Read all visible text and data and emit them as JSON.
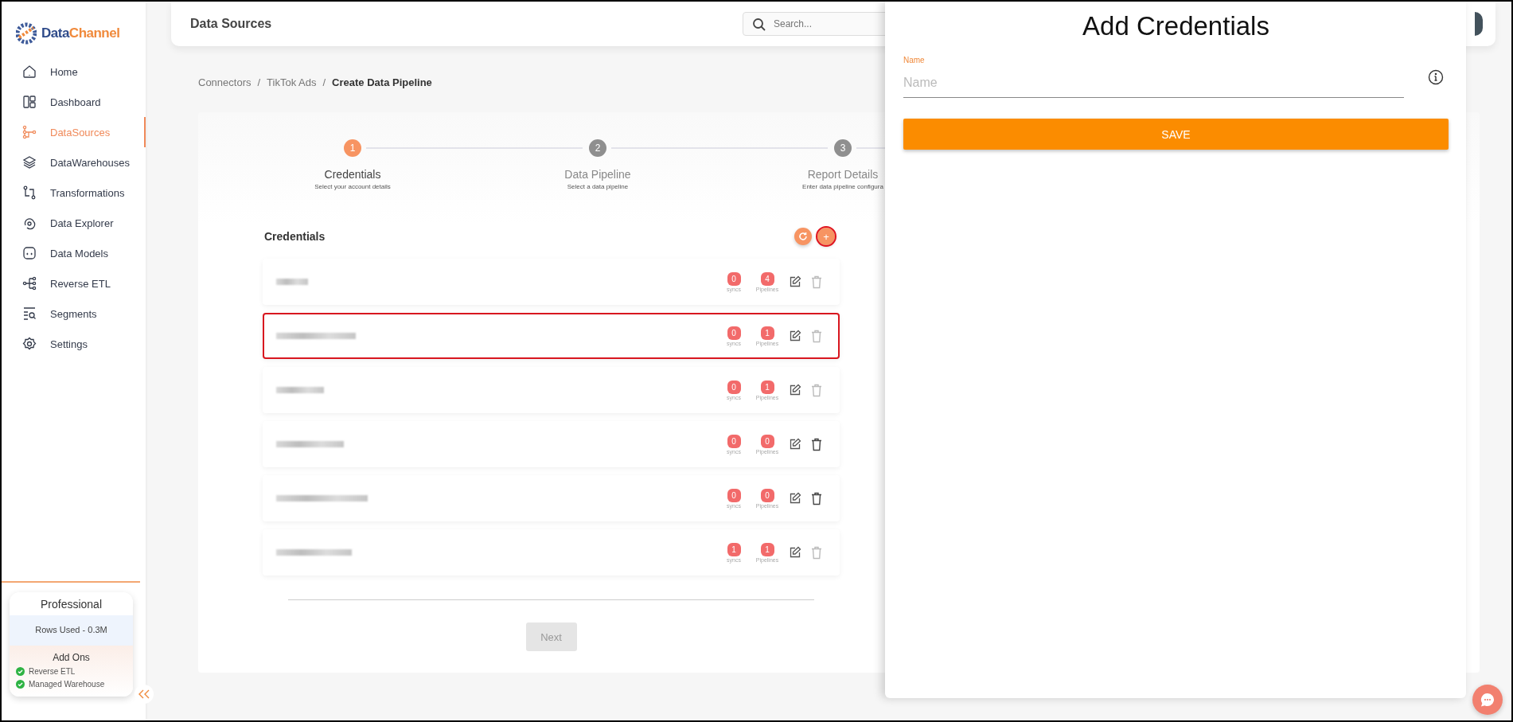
{
  "sidebar": {
    "logo": {
      "first": "Data",
      "second": "Channel"
    },
    "items": [
      {
        "label": "Home",
        "selected": false
      },
      {
        "label": "Dashboard",
        "selected": false
      },
      {
        "label": "DataSources",
        "selected": true
      },
      {
        "label": "DataWarehouses",
        "selected": false
      },
      {
        "label": "Transformations",
        "selected": false
      },
      {
        "label": "Data Explorer",
        "selected": false
      },
      {
        "label": "Data Models",
        "selected": false
      },
      {
        "label": "Reverse ETL",
        "selected": false
      },
      {
        "label": "Segments",
        "selected": false
      },
      {
        "label": "Settings",
        "selected": false
      }
    ],
    "plan": {
      "name": "Professional",
      "usage": "Rows Used - 0.3M",
      "addons_title": "Add Ons",
      "addons": [
        {
          "label": "Reverse ETL",
          "enabled": true
        },
        {
          "label": "Managed Warehouse",
          "enabled": true
        }
      ]
    }
  },
  "header": {
    "title": "Data Sources",
    "search": {
      "placeholder": "Search..."
    }
  },
  "breadcrumb": {
    "separator": "/",
    "items": [
      {
        "label": "Connectors",
        "current": false
      },
      {
        "label": "TikTok Ads",
        "current": false
      },
      {
        "label": "Create Data Pipeline",
        "current": true
      }
    ]
  },
  "stepper": [
    {
      "number": "1",
      "title": "Credentials",
      "subtitle": "Select your account details",
      "selected": true
    },
    {
      "number": "2",
      "title": "Data Pipeline",
      "subtitle": "Select a data pipeline",
      "selected": false
    },
    {
      "number": "3",
      "title": "Report Details",
      "subtitle": "Enter data pipeline configura",
      "selected": false
    }
  ],
  "credentials": {
    "title": "Credentials",
    "add_button": {
      "label": "+",
      "highlighted": true
    },
    "rows": [
      {
        "syncs": "0",
        "syncs_label": "syncs",
        "pipelines": "4",
        "pipelines_label": "Pipelines",
        "delete_disabled": true,
        "selected": false
      },
      {
        "syncs": "0",
        "syncs_label": "syncs",
        "pipelines": "1",
        "pipelines_label": "Pipelines",
        "delete_disabled": true,
        "selected": true
      },
      {
        "syncs": "0",
        "syncs_label": "syncs",
        "pipelines": "1",
        "pipelines_label": "Pipelines",
        "delete_disabled": true,
        "selected": false
      },
      {
        "syncs": "0",
        "syncs_label": "syncs",
        "pipelines": "0",
        "pipelines_label": "Pipelines",
        "delete_disabled": false,
        "selected": false
      },
      {
        "syncs": "0",
        "syncs_label": "syncs",
        "pipelines": "0",
        "pipelines_label": "Pipelines",
        "delete_disabled": false,
        "selected": false
      },
      {
        "syncs": "1",
        "syncs_label": "syncs",
        "pipelines": "1",
        "pipelines_label": "Pipelines",
        "delete_disabled": true,
        "selected": false
      }
    ],
    "next_button": {
      "label": "Next",
      "disabled": true
    }
  },
  "panel": {
    "title": "Add Credentials",
    "field": {
      "label": "Name",
      "placeholder": "Name"
    },
    "save_button": "SAVE"
  }
}
